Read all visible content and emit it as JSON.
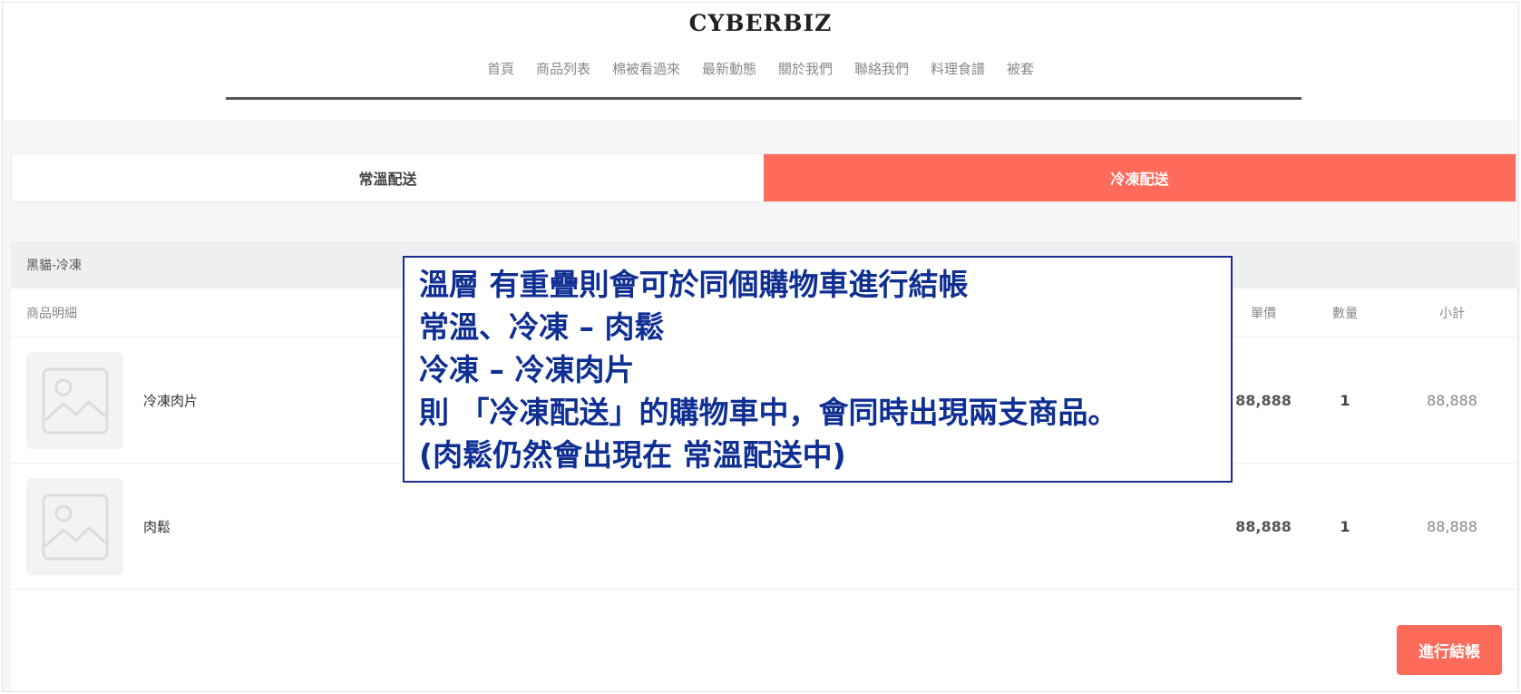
{
  "header": {
    "logo": "CYBERBIZ",
    "nav": [
      "首頁",
      "商品列表",
      "棉被看過來",
      "最新動態",
      "關於我們",
      "聯絡我們",
      "料理食譜",
      "被套"
    ]
  },
  "tabs": {
    "normal": "常溫配送",
    "frozen": "冷凍配送",
    "active": "冷凍配送"
  },
  "cart": {
    "group_label": "黑貓-冷凍",
    "columns": {
      "detail": "商品明細",
      "price": "單價",
      "qty": "數量",
      "subtotal": "小計"
    },
    "items": [
      {
        "name": "冷凍肉片",
        "price": "88,888",
        "qty": "1",
        "subtotal": "88,888"
      },
      {
        "name": "肉鬆",
        "price": "88,888",
        "qty": "1",
        "subtotal": "88,888"
      }
    ],
    "checkout_label": "進行結帳"
  },
  "annotation": {
    "lines": [
      "溫層 有重疊則會可於同個購物車進行結帳",
      "常溫、冷凍 – 肉鬆",
      "冷凍 – 冷凍肉片",
      "則 「冷凍配送」的購物車中，會同時出現兩支商品。",
      "(肉鬆仍然會出現在 常溫配送中)"
    ]
  },
  "colors": {
    "accent": "#fe6b5a",
    "annotation_text": "#0f2f93",
    "annotation_border": "#1a2d8c"
  },
  "icons": {
    "product_placeholder": "image-placeholder-icon"
  }
}
